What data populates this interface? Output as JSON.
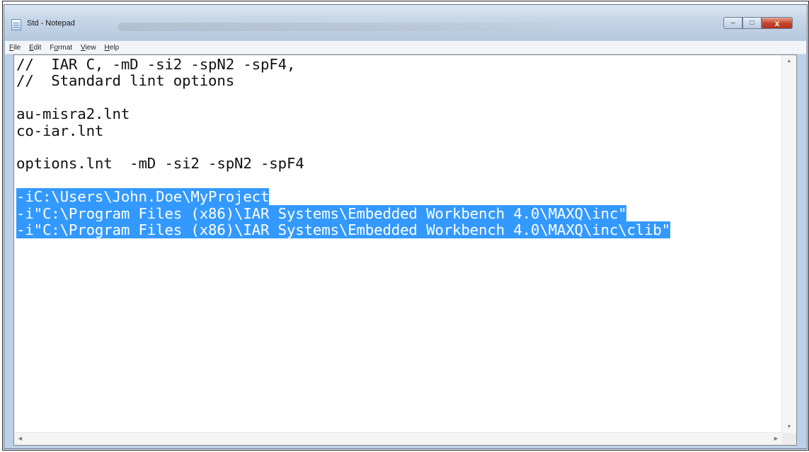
{
  "window": {
    "title": "Std - Notepad",
    "controls": {
      "minimize": "–",
      "maximize": "□",
      "close": "x"
    }
  },
  "menu": [
    {
      "underline": "F",
      "rest": "ile"
    },
    {
      "underline": "E",
      "rest": "dit"
    },
    {
      "underline": "",
      "rest": "F",
      "underline2": "o",
      "rest2": "rmat"
    },
    {
      "underline": "V",
      "rest": "iew"
    },
    {
      "underline": "H",
      "rest": "elp"
    }
  ],
  "editor": {
    "lines": [
      "//  IAR C, -mD -si2 -spN2 -spF4,",
      "//  Standard lint options",
      "",
      "au-misra2.lnt",
      "co-iar.lnt",
      "",
      "options.lnt  -mD -si2 -spN2 -spF4",
      "",
      "-iC:\\Users\\John.Doe\\MyProject",
      "-i\"C:\\Program Files (x86)\\IAR Systems\\Embedded Workbench 4.0\\MAXQ\\inc\"",
      "-i\"C:\\Program Files (x86)\\IAR Systems\\Embedded Workbench 4.0\\MAXQ\\inc\\clib\""
    ],
    "selected_line_indices": [
      8,
      9,
      10
    ],
    "selection_color": "#3399ff"
  },
  "scrollbars": {
    "up": "▲",
    "down": "▼",
    "left": "◀",
    "right": "▶"
  }
}
